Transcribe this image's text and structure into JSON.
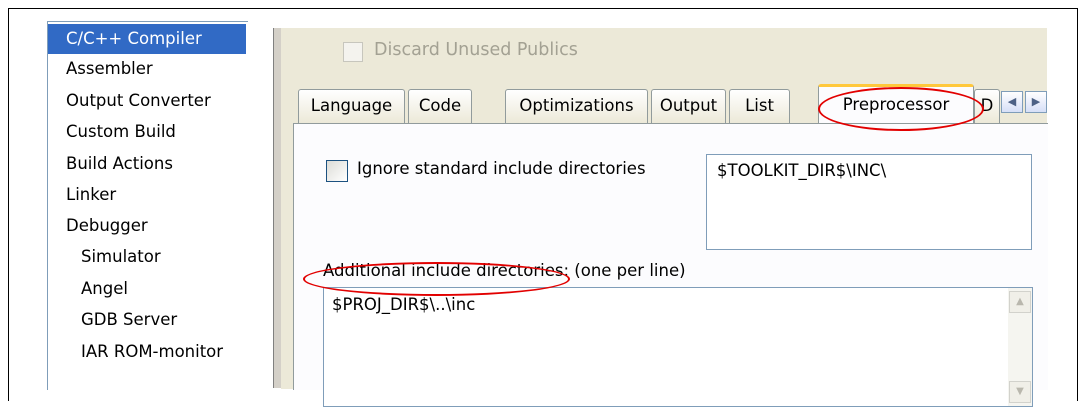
{
  "categories": [
    {
      "label": "C/C++ Compiler",
      "selected": true
    },
    {
      "label": "Assembler"
    },
    {
      "label": "Output Converter"
    },
    {
      "label": "Custom Build"
    },
    {
      "label": "Build Actions"
    },
    {
      "label": "Linker"
    },
    {
      "label": "Debugger"
    },
    {
      "label": "Simulator",
      "sub": true
    },
    {
      "label": "Angel",
      "sub": true
    },
    {
      "label": "GDB Server",
      "sub": true
    },
    {
      "label": "IAR ROM-monitor",
      "sub": true
    }
  ],
  "discard": {
    "label": "Discard Unused Publics",
    "checked": false,
    "disabled": true
  },
  "tabs": [
    "Language",
    "Code",
    "Optimizations",
    "Output",
    "List",
    "Preprocessor",
    "D"
  ],
  "active_tab": "Preprocessor",
  "tab_scroll": {
    "left": "◀",
    "right": "▶"
  },
  "ignore": {
    "label": "Ignore standard include directories",
    "checked": false
  },
  "standard_include": "$TOOLKIT_DIR$\\INC\\",
  "additional": {
    "label": "Additional include directories: (one per line)",
    "value": "$PROJ_DIR$\\..\\inc"
  },
  "scroll": {
    "up": "▲",
    "down": "▼"
  },
  "highlight_color": "#e20000",
  "selection_color": "#316ac5"
}
